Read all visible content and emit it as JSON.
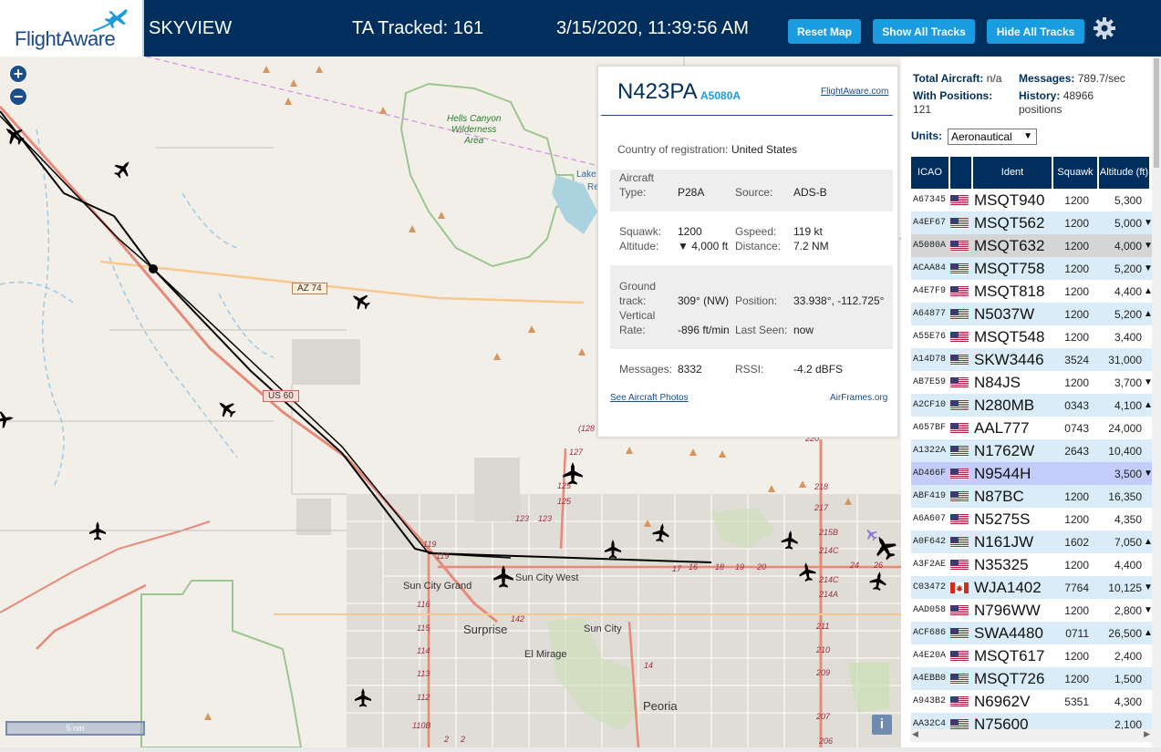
{
  "header": {
    "logo_text": "FlightAware",
    "app_name": "SKYVIEW",
    "tracked": "TA Tracked: 161",
    "datetime": "3/15/2020, 11:39:56 AM",
    "reset_label": "Reset Map",
    "show_label": "Show All Tracks",
    "hide_label": "Hide All Tracks",
    "accent": "#1b9be0",
    "bg": "#002f5d"
  },
  "map": {
    "zoom_in": "+",
    "zoom_out": "−",
    "scale_label": "5 nm",
    "info": "i",
    "labels": {
      "hells1": "Hells Canyon",
      "hells2": "Wilderness",
      "hells3": "Area",
      "lake": "Lake",
      "lake2": "Re",
      "az74": "AZ 74",
      "us60": "US 60",
      "suncitygrand": "Sun City Grand",
      "suncitywest": "Sun City West",
      "surprise": "Surprise",
      "suncity": "Sun City",
      "elmirage": "El Mirage",
      "peoria": "Peoria",
      "r119a": "119",
      "r119b": "119",
      "r116": "116",
      "r115": "115",
      "r114": "114",
      "r113": "113",
      "r112": "112",
      "r110b": "110B",
      "r142": "142",
      "r125": "125",
      "r125b": "125",
      "r123a": "123",
      "r123b": "123",
      "r127": "127",
      "r128": "(128",
      "r220": "220",
      "r218": "218",
      "r217": "217",
      "r215b": "215B",
      "r214c": "214C",
      "r214c2": "214C",
      "r214a": "214A",
      "r211": "211",
      "r210": "210",
      "r209": "209",
      "r207": "207",
      "r206": "206",
      "r17": "17",
      "r16": "16",
      "r18": "18",
      "r19": "19",
      "r20": "20",
      "r24": "24",
      "r26": "26",
      "r2a": "2",
      "r2b": "2",
      "r14": "14"
    }
  },
  "popup": {
    "ident": "N423PA",
    "hex": "A5080A",
    "fa_link": "FlightAware.com",
    "country_label": "Country of registration:",
    "country": "United States",
    "type_label1": "Aircraft",
    "type_label2": "Type:",
    "type": "P28A",
    "source_label": "Source:",
    "source": "ADS-B",
    "squawk_label": "Squawk:",
    "squawk": "1200",
    "gspeed_label": "Gspeed:",
    "gspeed": "119 kt",
    "alt_label": "Altitude:",
    "alt": "▼ 4,000 ft",
    "dist_label": "Distance:",
    "dist": "7.2 NM",
    "gt_label1": "Ground",
    "gt_label2": "track:",
    "gt": "309° (NW)",
    "pos_label": "Position:",
    "pos": "33.938°, -112.725°",
    "vr_label1": "Vertical",
    "vr_label2": "Rate:",
    "vr": "-896 ft/min",
    "seen_label": "Last Seen:",
    "seen": "now",
    "msg_label": "Messages:",
    "msg": "8332",
    "rssi_label": "RSSI:",
    "rssi": "-4.2 dBFS",
    "photos_link": "See Aircraft Photos",
    "airframes_link": "AirFrames.org"
  },
  "sidebar": {
    "total_label": "Total Aircraft:",
    "total": "n/a",
    "messages_label": "Messages:",
    "messages": "789.7/sec",
    "withpos_label": "With Positions:",
    "withpos": "121",
    "history_label": "History:",
    "history1": "48966",
    "history2": "positions",
    "units_label": "Units:",
    "units_value": "Aeronautical",
    "columns": [
      "ICAO",
      "Ident",
      "Squawk",
      "Altitude (ft)"
    ],
    "rows": [
      {
        "icao": "A67345",
        "flag": "us",
        "ident": "MSQT940",
        "squawk": "1200",
        "alt": "5,300",
        "trend": ""
      },
      {
        "icao": "A4EF67",
        "flag": "us",
        "ident": "MSQT562",
        "squawk": "1200",
        "alt": "5,000",
        "trend": "▼"
      },
      {
        "icao": "A5080A",
        "flag": "us",
        "ident": "MSQT632",
        "squawk": "1200",
        "alt": "4,000",
        "trend": "▼"
      },
      {
        "icao": "ACAA84",
        "flag": "us",
        "ident": "MSQT758",
        "squawk": "1200",
        "alt": "5,200",
        "trend": "▼"
      },
      {
        "icao": "A4E7F9",
        "flag": "us",
        "ident": "MSQT818",
        "squawk": "1200",
        "alt": "4,400",
        "trend": "▲"
      },
      {
        "icao": "A64877",
        "flag": "us",
        "ident": "N5037W",
        "squawk": "1200",
        "alt": "5,200",
        "trend": "▲"
      },
      {
        "icao": "A55E76",
        "flag": "us",
        "ident": "MSQT548",
        "squawk": "1200",
        "alt": "3,400",
        "trend": ""
      },
      {
        "icao": "A14D78",
        "flag": "us",
        "ident": "SKW3446",
        "squawk": "3524",
        "alt": "31,000",
        "trend": ""
      },
      {
        "icao": "AB7E59",
        "flag": "us",
        "ident": "N84JS",
        "squawk": "1200",
        "alt": "3,700",
        "trend": "▼"
      },
      {
        "icao": "A2CF10",
        "flag": "us",
        "ident": "N280MB",
        "squawk": "0343",
        "alt": "4,100",
        "trend": "▲"
      },
      {
        "icao": "A657BF",
        "flag": "us",
        "ident": "AAL777",
        "squawk": "0743",
        "alt": "24,000",
        "trend": ""
      },
      {
        "icao": "A1322A",
        "flag": "us",
        "ident": "N1762W",
        "squawk": "2643",
        "alt": "10,400",
        "trend": ""
      },
      {
        "icao": "AD466F",
        "flag": "us",
        "ident": "N9544H",
        "squawk": "",
        "alt": "3,500",
        "trend": "▼"
      },
      {
        "icao": "ABF419",
        "flag": "us",
        "ident": "N87BC",
        "squawk": "1200",
        "alt": "16,350",
        "trend": ""
      },
      {
        "icao": "A6A607",
        "flag": "us",
        "ident": "N5275S",
        "squawk": "1200",
        "alt": "4,350",
        "trend": ""
      },
      {
        "icao": "A0F642",
        "flag": "us",
        "ident": "N161JW",
        "squawk": "1602",
        "alt": "7,050",
        "trend": "▲"
      },
      {
        "icao": "A3F2AE",
        "flag": "us",
        "ident": "N35325",
        "squawk": "1200",
        "alt": "4,400",
        "trend": ""
      },
      {
        "icao": "C03472",
        "flag": "ca",
        "ident": "WJA1402",
        "squawk": "7764",
        "alt": "10,125",
        "trend": "▼"
      },
      {
        "icao": "AAD058",
        "flag": "us",
        "ident": "N796WW",
        "squawk": "1200",
        "alt": "2,800",
        "trend": "▼"
      },
      {
        "icao": "ACF686",
        "flag": "us",
        "ident": "SWA4480",
        "squawk": "0711",
        "alt": "26,500",
        "trend": "▲"
      },
      {
        "icao": "A4E20A",
        "flag": "us",
        "ident": "MSQT617",
        "squawk": "1200",
        "alt": "2,400",
        "trend": ""
      },
      {
        "icao": "A4EBB0",
        "flag": "us",
        "ident": "MSQT726",
        "squawk": "1200",
        "alt": "1,500",
        "trend": ""
      },
      {
        "icao": "A943B2",
        "flag": "us",
        "ident": "N6962V",
        "squawk": "5351",
        "alt": "4,300",
        "trend": ""
      },
      {
        "icao": "AA32C4",
        "flag": "us",
        "ident": "N75600",
        "squawk": "",
        "alt": "2,100",
        "trend": ""
      }
    ]
  }
}
